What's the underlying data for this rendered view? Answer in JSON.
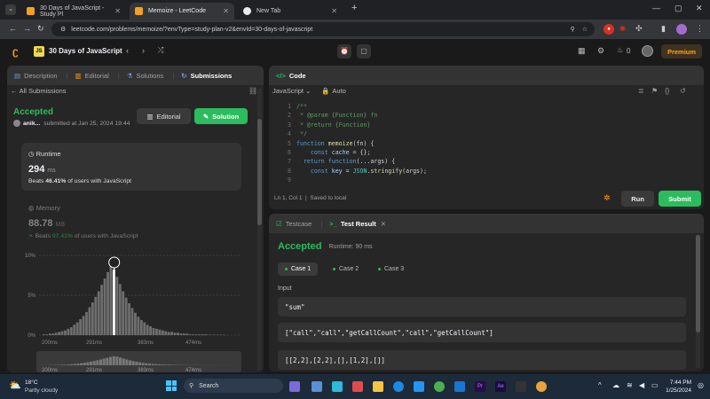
{
  "browser": {
    "tabs": [
      {
        "title": "30 Days of JavaScript - Study Pl",
        "favicon_color": "#f89f1b"
      },
      {
        "title": "Memoize - LeetCode",
        "favicon_color": "#f89f1b"
      },
      {
        "title": "New Tab",
        "favicon_color": "#e8eaed"
      }
    ],
    "url": "leetcode.com/problems/memoize/?envType=study-plan-v2&envId=30-days-of-javascript",
    "profile_badge": "2"
  },
  "lc": {
    "study_plan_title": "30 Days of JavaScript",
    "streak_count": "0",
    "premium_label": "Premium"
  },
  "left_panel": {
    "tabs": [
      "Description",
      "Editorial",
      "Solutions",
      "Submissions"
    ],
    "all_submissions": "All Submissions",
    "status": "Accepted",
    "user": "anik...",
    "submitted_text": "submitted at Jan 25, 2024 19:44",
    "editorial_btn": "Editorial",
    "solution_btn": "Solution",
    "runtime": {
      "label": "Runtime",
      "value": "294",
      "unit": "ms",
      "beats_prefix": "Beats",
      "beats_value": "46.41%",
      "beats_suffix": "of users with JavaScript"
    },
    "memory": {
      "label": "Memory",
      "value": "88.78",
      "unit": "MB",
      "beats_prefix": "Beats",
      "beats_value": "97.41%",
      "beats_suffix": "of users with JavaScript"
    }
  },
  "chart_data": {
    "type": "bar",
    "title": "",
    "xlabel": "",
    "ylabel": "",
    "y_ticks": [
      "10%",
      "5%",
      "0%"
    ],
    "x_ticks": [
      "200ms",
      "291ms",
      "383ms",
      "474ms"
    ],
    "ylim": [
      0,
      10
    ],
    "highlight_x": "291ms",
    "values": [
      0.1,
      0.1,
      0.2,
      0.2,
      0.3,
      0.4,
      0.5,
      0.6,
      0.8,
      1.0,
      1.3,
      1.6,
      2.0,
      2.4,
      2.9,
      3.5,
      4.1,
      4.8,
      5.5,
      6.3,
      7.1,
      7.9,
      8.6,
      8.2,
      7.3,
      6.4,
      5.5,
      4.7,
      4.0,
      3.4,
      2.8,
      2.3,
      1.9,
      1.6,
      1.3,
      1.1,
      0.9,
      0.8,
      0.7,
      0.6,
      0.5,
      0.4,
      0.4,
      0.3,
      0.3,
      0.2,
      0.2,
      0.2,
      0.1,
      0.1,
      0.1,
      0.1,
      0.1,
      0.1,
      0.05,
      0.05,
      0.05,
      0.05,
      0.05,
      0.05
    ],
    "mini_x_ticks": [
      "200ms",
      "291ms",
      "383ms",
      "474ms"
    ]
  },
  "code_panel": {
    "title": "Code",
    "language": "JavaScript",
    "auto_label": "Auto",
    "lines": [
      {
        "n": "1",
        "parts": [
          [
            "cs",
            "/**"
          ]
        ]
      },
      {
        "n": "2",
        "parts": [
          [
            "cs",
            " * @param {Function} fn"
          ]
        ]
      },
      {
        "n": "3",
        "parts": [
          [
            "cs",
            " * @return {Function}"
          ]
        ]
      },
      {
        "n": "4",
        "parts": [
          [
            "cs",
            " */"
          ]
        ]
      },
      {
        "n": "5",
        "parts": [
          [
            "kw",
            "function "
          ],
          [
            "fn",
            "memoize"
          ],
          [
            "pl",
            "(fn) {"
          ]
        ]
      },
      {
        "n": "6",
        "parts": [
          [
            "pl",
            "    "
          ],
          [
            "kw",
            "const "
          ],
          [
            "vr",
            "cache"
          ],
          [
            "pl",
            " = {};"
          ]
        ]
      },
      {
        "n": "7",
        "parts": [
          [
            "pl",
            "  "
          ],
          [
            "kw",
            "return "
          ],
          [
            "kw",
            "function"
          ],
          [
            "pl",
            "(...args) {"
          ]
        ]
      },
      {
        "n": "8",
        "parts": [
          [
            "pl",
            "    "
          ],
          [
            "kw",
            "const "
          ],
          [
            "vr",
            "key"
          ],
          [
            "pl",
            " = "
          ],
          [
            "tp",
            "JSON"
          ],
          [
            "pl",
            "."
          ],
          [
            "fn",
            "stringify"
          ],
          [
            "pl",
            "(args);"
          ]
        ]
      },
      {
        "n": "9",
        "parts": []
      }
    ],
    "status_pos": "Ln 1, Col 1",
    "status_saved": "Saved to local",
    "run_btn": "Run",
    "submit_btn": "Submit"
  },
  "result_panel": {
    "tabs": [
      "Testcase",
      "Test Result"
    ],
    "status": "Accepted",
    "runtime": "Runtime: 90 ms",
    "cases": [
      "Case 1",
      "Case 2",
      "Case 3"
    ],
    "input_label": "Input",
    "inputs": [
      "\"sum\"",
      "[\"call\",\"call\",\"getCallCount\",\"call\",\"getCallCount\"]",
      "[[2,2],[2,2],[],[1,2],[]]"
    ]
  },
  "taskbar": {
    "temperature": "18°C",
    "weather": "Partly cloudy",
    "search_placeholder": "Search",
    "time": "7:44 PM",
    "date": "1/25/2024"
  }
}
